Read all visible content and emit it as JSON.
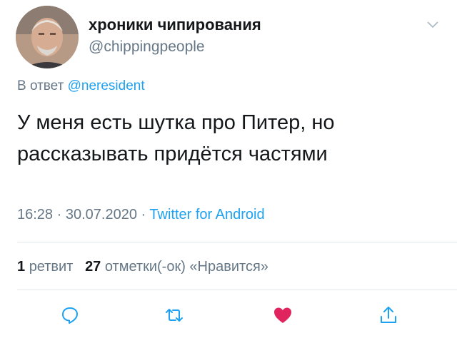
{
  "author": {
    "display_name": "хроники чипирования",
    "handle": "@chippingpeople"
  },
  "reply": {
    "prefix": "В ответ",
    "mention": "@neresident"
  },
  "tweet": {
    "text_line1": "У меня есть шутка про Питер, но",
    "text_line2": "рассказывать придётся частями"
  },
  "meta": {
    "time": "16:28",
    "separator": "·",
    "date": "30.07.2020",
    "source": "Twitter for Android"
  },
  "stats": {
    "retweets_count": "1",
    "retweets_label": "ретвит",
    "likes_count": "27",
    "likes_label": "отметки(-ок) «Нравится»"
  },
  "actions": [
    {
      "icon": "reply-icon"
    },
    {
      "icon": "retweet-icon"
    },
    {
      "icon": "like-heart-icon",
      "active": true
    },
    {
      "icon": "share-icon"
    }
  ],
  "colors": {
    "accent": "#1da1f2",
    "secondary_text": "#657786",
    "like": "#e0245e"
  }
}
